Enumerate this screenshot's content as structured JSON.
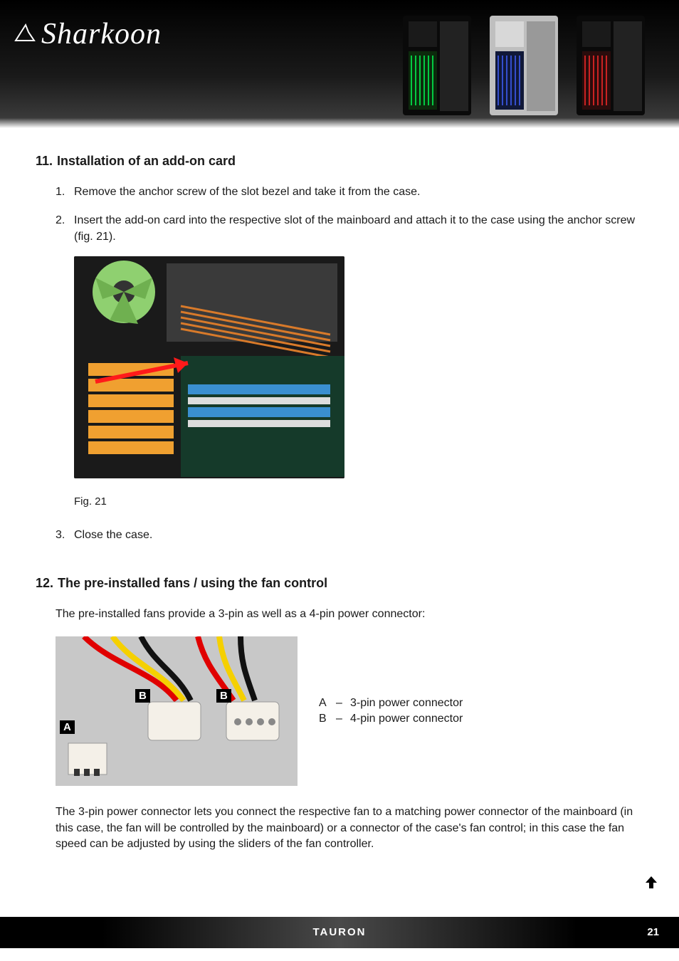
{
  "brand": "Sharkoon",
  "section11": {
    "number": "11.",
    "title": "Installation of an add-on card",
    "steps": [
      {
        "num": "1.",
        "text": "Remove the anchor screw of the slot bezel and take it from the case."
      },
      {
        "num": "2.",
        "text": "Insert the add-on card into the respective slot of the mainboard and attach it to the case using the anchor screw (fig. 21)."
      },
      {
        "num": "3.",
        "text": "Close the case."
      }
    ],
    "figure_caption": "Fig. 21"
  },
  "section12": {
    "number": "12.",
    "title": "The pre-installed fans / using the fan control",
    "intro": "The pre-installed fans provide a 3-pin as well as a 4-pin power connector:",
    "labels": {
      "a": "A",
      "b": "B"
    },
    "legend": [
      {
        "key": "A",
        "dash": "–",
        "value": "3-pin power connector"
      },
      {
        "key": "B",
        "dash": "–",
        "value": "4-pin power connector"
      }
    ],
    "body": "The 3-pin power connector lets you connect the respective fan to a matching power connector of the mainboard (in this case, the fan will be controlled by the mainboard) or a connector of the case's fan control; in this case the fan speed can be adjusted by using the sliders of the fan controller."
  },
  "footer": {
    "product": "TAURON",
    "page": "21"
  }
}
